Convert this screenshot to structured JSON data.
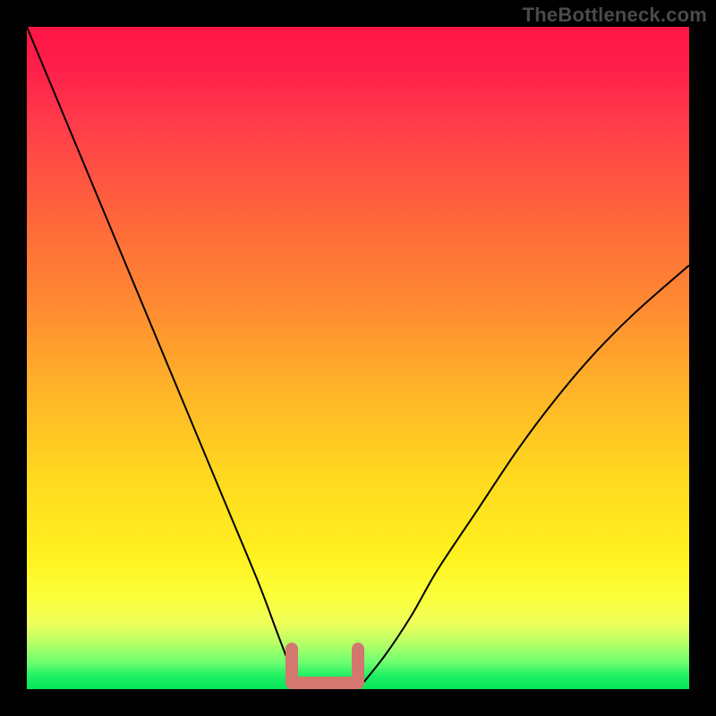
{
  "watermark": "TheBottleneck.com",
  "colors": {
    "frame_bg": "#000000",
    "watermark_text": "#4a4a4a",
    "curve_stroke": "#000000",
    "bracket_stroke": "#d4776f",
    "gradient_stops": [
      "#ff1646",
      "#ff8a32",
      "#fff120",
      "#06e75b"
    ]
  },
  "chart_data": {
    "type": "line",
    "title": "",
    "xlabel": "",
    "ylabel": "",
    "x_range": [
      0,
      100
    ],
    "y_range": [
      0,
      100
    ],
    "series": [
      {
        "name": "left-branch",
        "x": [
          0,
          5,
          10,
          15,
          20,
          25,
          30,
          35,
          38,
          40,
          42
        ],
        "y": [
          100,
          88,
          76,
          64,
          52,
          40,
          28,
          16,
          8,
          3,
          0
        ]
      },
      {
        "name": "right-branch",
        "x": [
          50,
          54,
          58,
          62,
          68,
          74,
          80,
          86,
          92,
          100
        ],
        "y": [
          0,
          5,
          11,
          18,
          27,
          36,
          44,
          51,
          57,
          64
        ]
      }
    ],
    "highlight_bracket": {
      "description": "salmon bracket marking the flat minimum region",
      "x_start": 40,
      "x_end": 50,
      "y": 0
    },
    "color_legend": {
      "description": "vertical gradient encodes value (top=high/red, bottom=low/green)",
      "top": "#ff1646",
      "bottom": "#06e75b"
    }
  }
}
